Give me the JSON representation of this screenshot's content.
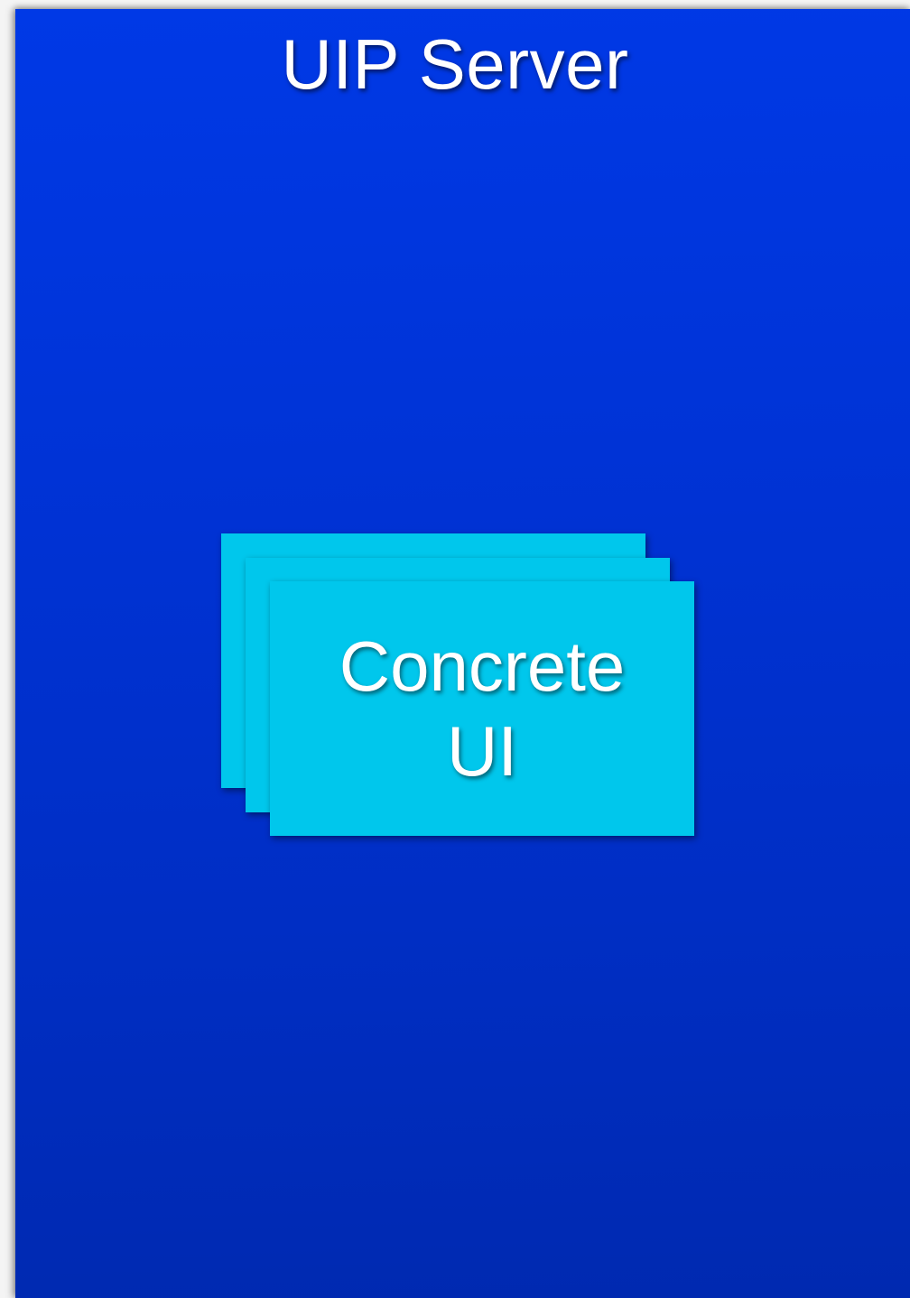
{
  "server": {
    "title": "UIP Server"
  },
  "concrete_ui": {
    "label_line1": "Concrete",
    "label_line2": "UI"
  },
  "colors": {
    "server_background": "#0033d6",
    "card_background": "#00c7ec",
    "text": "#ffffff"
  }
}
